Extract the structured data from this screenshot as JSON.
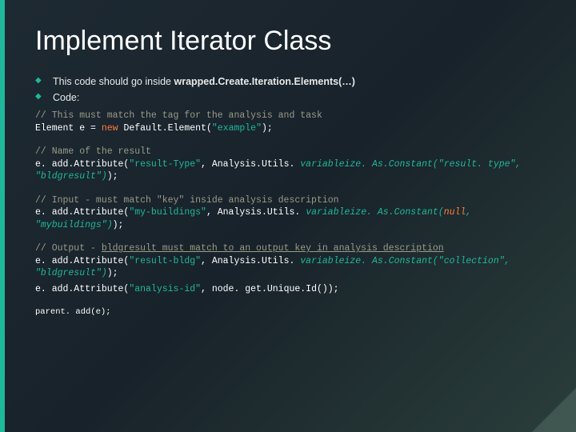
{
  "title": "Implement Iterator Class",
  "bullets": {
    "b0_a": "This code should go inside ",
    "b0_b": "wrapped.Create.Iteration.Elements(…)",
    "b1": "Code:"
  },
  "code": {
    "c1": "// This must match the tag for the analysis and task",
    "l1a": "Element e = ",
    "l1b": "new",
    "l1c": " Default.Element(",
    "l1d": "\"example\"",
    "l1e": ");",
    "c2": "// Name of the result",
    "l2a": "e. add.Attribute(",
    "l2b": "\"result-Type\"",
    "l2c": ", Analysis.Utils. ",
    "l2d": "variableize. As.Constant(\"result. type\", \"bldgresult\")",
    "l2e": ");",
    "c3": "// Input - must match \"key\" inside analysis description",
    "l3a": "e. add.Attribute(",
    "l3b": "\"my-buildings\"",
    "l3c": ", Analysis.Utils. ",
    "l3d": "variableize. As.Constant(",
    "l3e": "null",
    "l3f": ", \"mybuildings\")",
    "l3g": ");",
    "c4a": "// Output - ",
    "c4b": "bldgresult must match to an output key in analysis description",
    "l4a": "e. add.Attribute(",
    "l4b": "\"result-bldg\"",
    "l4c": ", Analysis.Utils. ",
    "l4d": "variableize. As.Constant(\"collection\", \"bldgresult\")",
    "l4e": ");",
    "l5a": "e. add.Attribute(",
    "l5b": "\"analysis-id\"",
    "l5c": ", node. get.Unique.Id());",
    "l6": "parent. add(e);"
  }
}
